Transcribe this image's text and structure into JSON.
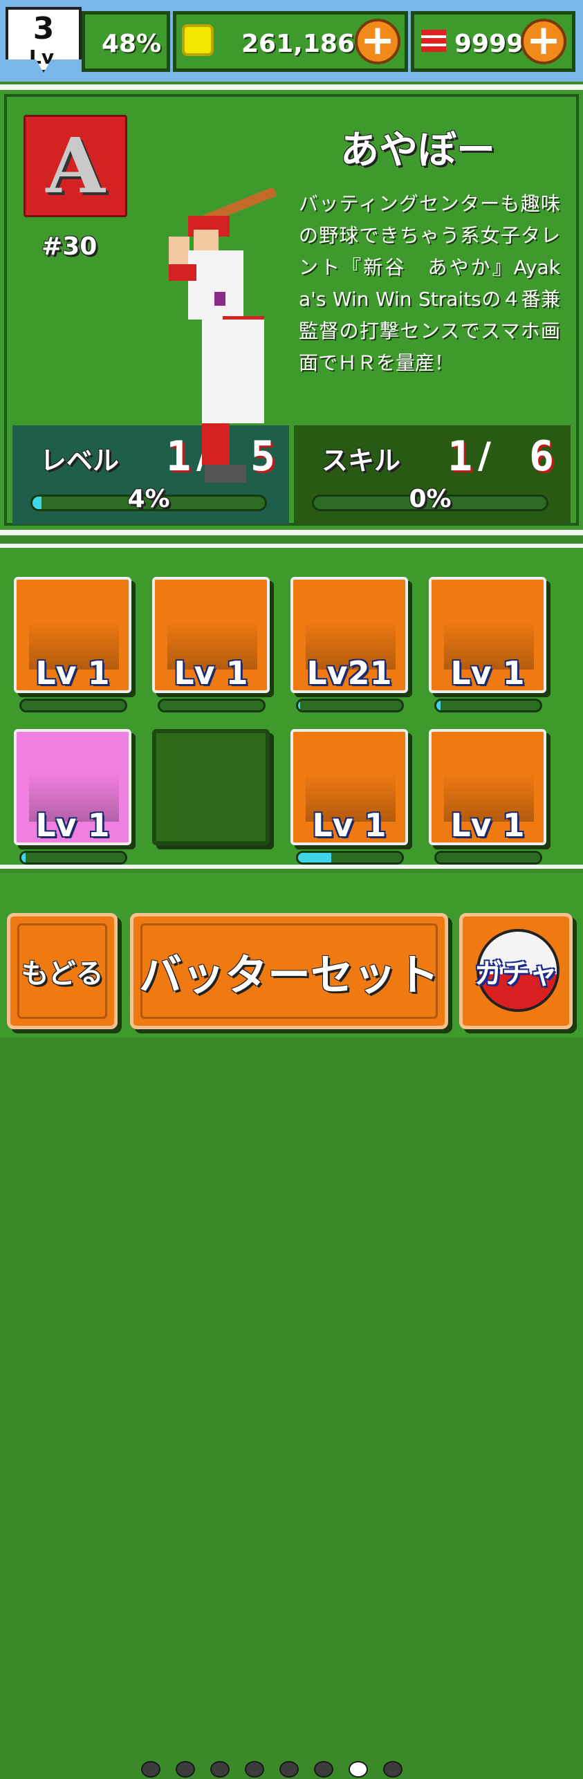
{
  "header": {
    "player_level": "3",
    "player_level_label": "Lv",
    "exp_percent": "48%",
    "coins": "261,186",
    "tickets": "9999",
    "plus_glyph": "+",
    "icons": {
      "coin": "coin-icon",
      "ticket": "ticket-icon",
      "plus": "plus-icon"
    }
  },
  "character": {
    "team_letter": "A",
    "uniform_number": "#30",
    "name": "あやぼー",
    "description": "バッティングセンターも趣味の野球できちゃう系女子タレント『新谷　あやか』Ayaka's Win Win Straitsの４番兼監督の打撃センスでスマホ画面でＨＲを量産！",
    "level": {
      "label": "レベル",
      "current": "1",
      "separator": "/",
      "max": "5",
      "progress_text": "4%",
      "progress": 0.04
    },
    "skill": {
      "label": "スキル",
      "current": "1",
      "separator": "/",
      "max": "6",
      "progress_text": "0%",
      "progress": 0.0
    }
  },
  "roster": [
    {
      "level": "Lv 1",
      "color": "orange",
      "progress": 0.0
    },
    {
      "level": "Lv 1",
      "color": "orange",
      "progress": 0.0
    },
    {
      "level": "Lv21",
      "color": "orange",
      "progress": 0.02
    },
    {
      "level": "Lv 1",
      "color": "orange",
      "progress": 0.04
    },
    {
      "level": "Lv 1",
      "color": "pink",
      "progress": 0.04
    },
    {
      "level": "",
      "color": "empty",
      "progress": null
    },
    {
      "level": "Lv 1",
      "color": "orange",
      "progress": 0.32
    },
    {
      "level": "Lv 1",
      "color": "orange",
      "progress": 0.0
    }
  ],
  "pager": {
    "total": 8,
    "active_index": 6
  },
  "buttons": {
    "back": "もどる",
    "set_batter": "バッターセット",
    "gacha": "ガチャ"
  },
  "colors": {
    "background_green": "#3f9a2e",
    "sky": "#7ab6ea",
    "accent_orange": "#f07a12",
    "progress_cyan": "#3fd6ea",
    "team_red": "#d42121"
  }
}
